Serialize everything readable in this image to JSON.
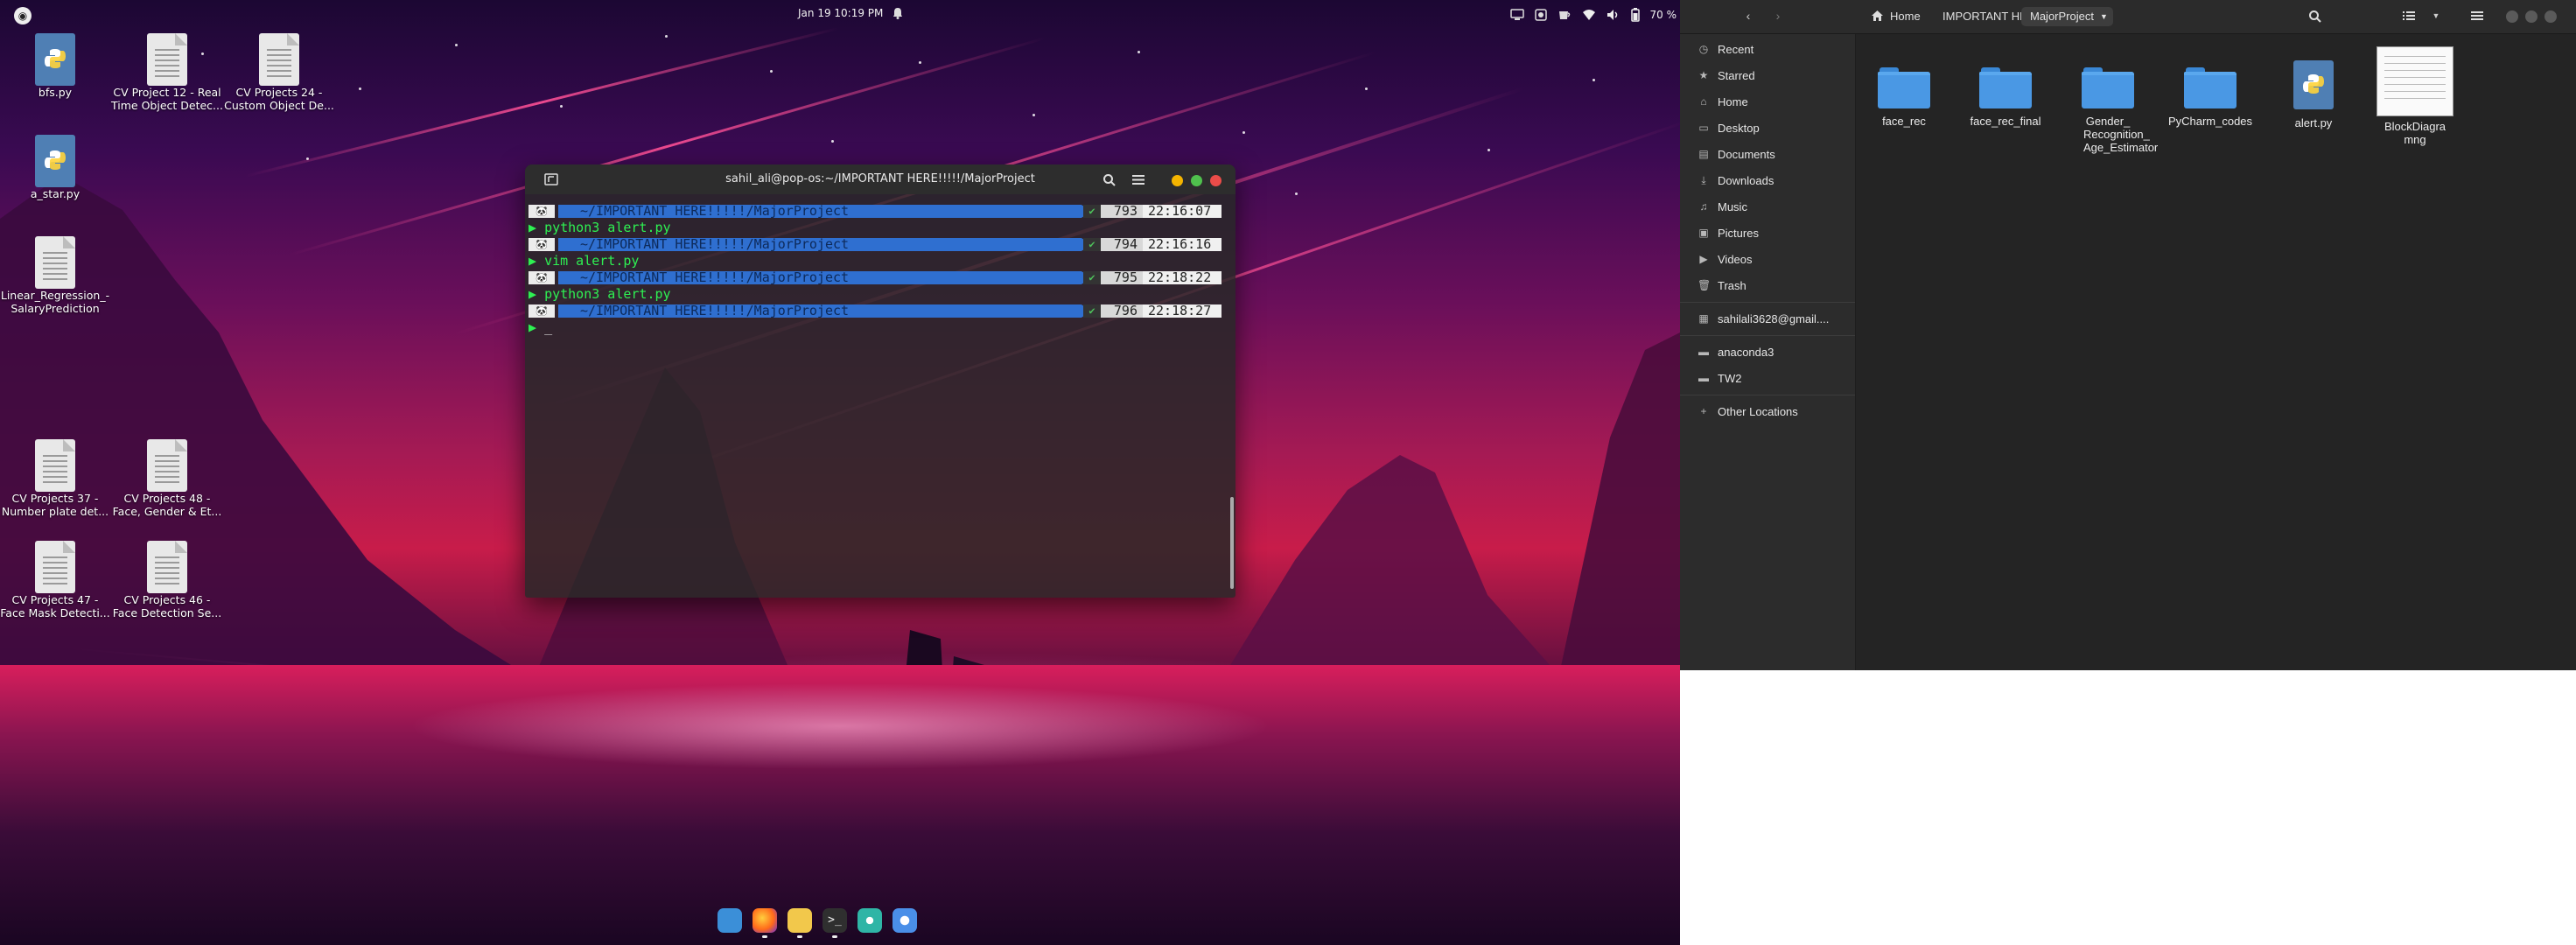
{
  "topbar": {
    "datetime": "Jan 19  10:19 PM",
    "battery": "70 %"
  },
  "desktop_icons": [
    {
      "label": "bfs.py",
      "kind": "python"
    },
    {
      "label": "CV Project 12 - Real Time Object Detec...",
      "kind": "document"
    },
    {
      "label": "CV Projects 24 - Custom Object De...",
      "kind": "document"
    },
    {
      "label": "a_star.py",
      "kind": "python"
    },
    {
      "label": "Linear_Regression_-SalaryPrediction",
      "kind": "document"
    },
    {
      "label": "CV Projects 37 - Number plate det...",
      "kind": "document"
    },
    {
      "label": "CV Projects 48 - Face, Gender & Et...",
      "kind": "document"
    },
    {
      "label": "CV Projects 47 - Face Mask Detecti...",
      "kind": "document"
    },
    {
      "label": "CV Projects 46 - Face Detection Se...",
      "kind": "document"
    }
  ],
  "terminal": {
    "title": "sahil_ali@pop-os:~/IMPORTANT HERE!!!!!/MajorProject",
    "prompt_path": "~/IMPORTANT HERE!!!!!/MajorProject",
    "lines": [
      {
        "type": "prompt",
        "num": "793",
        "time": "22:16:07"
      },
      {
        "type": "cmd",
        "text": "python3 alert.py"
      },
      {
        "type": "prompt",
        "num": "794",
        "time": "22:16:16"
      },
      {
        "type": "cmd",
        "text": "vim alert.py"
      },
      {
        "type": "prompt",
        "num": "795",
        "time": "22:18:22"
      },
      {
        "type": "cmd",
        "text": "python3 alert.py"
      },
      {
        "type": "prompt",
        "num": "796",
        "time": "22:18:27"
      },
      {
        "type": "cmd",
        "text": "_"
      }
    ]
  },
  "files": {
    "breadcrumbs": [
      "Home",
      "IMPORTANT HERE!!!!!",
      "MajorProject"
    ],
    "sidebar": [
      {
        "label": "Recent",
        "icon": "clock-icon"
      },
      {
        "label": "Starred",
        "icon": "star-icon"
      },
      {
        "label": "Home",
        "icon": "home-icon"
      },
      {
        "label": "Desktop",
        "icon": "desktop-icon"
      },
      {
        "label": "Documents",
        "icon": "documents-icon"
      },
      {
        "label": "Downloads",
        "icon": "download-icon"
      },
      {
        "label": "Music",
        "icon": "music-icon"
      },
      {
        "label": "Pictures",
        "icon": "pictures-icon"
      },
      {
        "label": "Videos",
        "icon": "videos-icon"
      },
      {
        "label": "Trash",
        "icon": "trash-icon"
      },
      {
        "label": "sahilali3628@gmail....",
        "icon": "account-icon"
      },
      {
        "label": "anaconda3",
        "icon": "folder-icon"
      },
      {
        "label": "TW2",
        "icon": "folder-icon"
      },
      {
        "label": "Other Locations",
        "icon": "plus-icon"
      }
    ],
    "items": [
      {
        "label": "face_rec",
        "kind": "folder"
      },
      {
        "label": "face_rec_final",
        "kind": "folder"
      },
      {
        "label": "Gender_ Recognition_ Age_Estimator",
        "kind": "folder"
      },
      {
        "label": "PyCharm_codes",
        "kind": "folder"
      },
      {
        "label": "alert.py",
        "kind": "python"
      },
      {
        "label": "BlockDiagramng",
        "kind": "image"
      }
    ]
  },
  "colors": {
    "terminal_path": "#2f6fd0",
    "terminal_cmd": "#2ef052",
    "folder_blue": "#4a98e4"
  }
}
